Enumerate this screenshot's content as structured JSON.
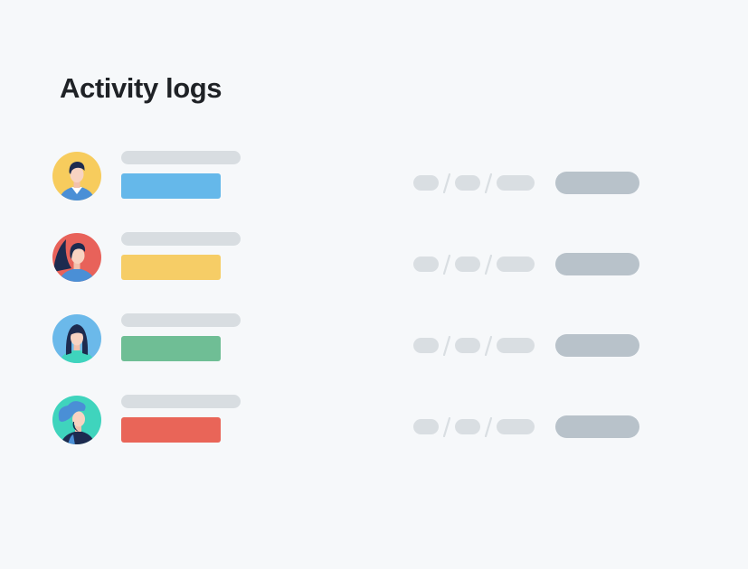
{
  "header": {
    "title": "Activity logs"
  },
  "colors": {
    "background": "#f6f8fa",
    "skeleton_light": "#d8dde1",
    "skeleton_dark": "#b8c2ca",
    "title_text": "#1f2226"
  },
  "logs": [
    {
      "avatar_icon": "user-avatar-man-icon",
      "avatar_bg": "#f7cc5d",
      "tag_color": "#65b8ea"
    },
    {
      "avatar_icon": "user-avatar-woman-ponytail-icon",
      "avatar_bg": "#e8625a",
      "tag_color": "#f6cd66"
    },
    {
      "avatar_icon": "user-avatar-woman-long-hair-icon",
      "avatar_bg": "#6bb9ea",
      "tag_color": "#6fbe95"
    },
    {
      "avatar_icon": "user-avatar-woman-hat-icon",
      "avatar_bg": "#3fd4bd",
      "tag_color": "#e96558"
    }
  ]
}
